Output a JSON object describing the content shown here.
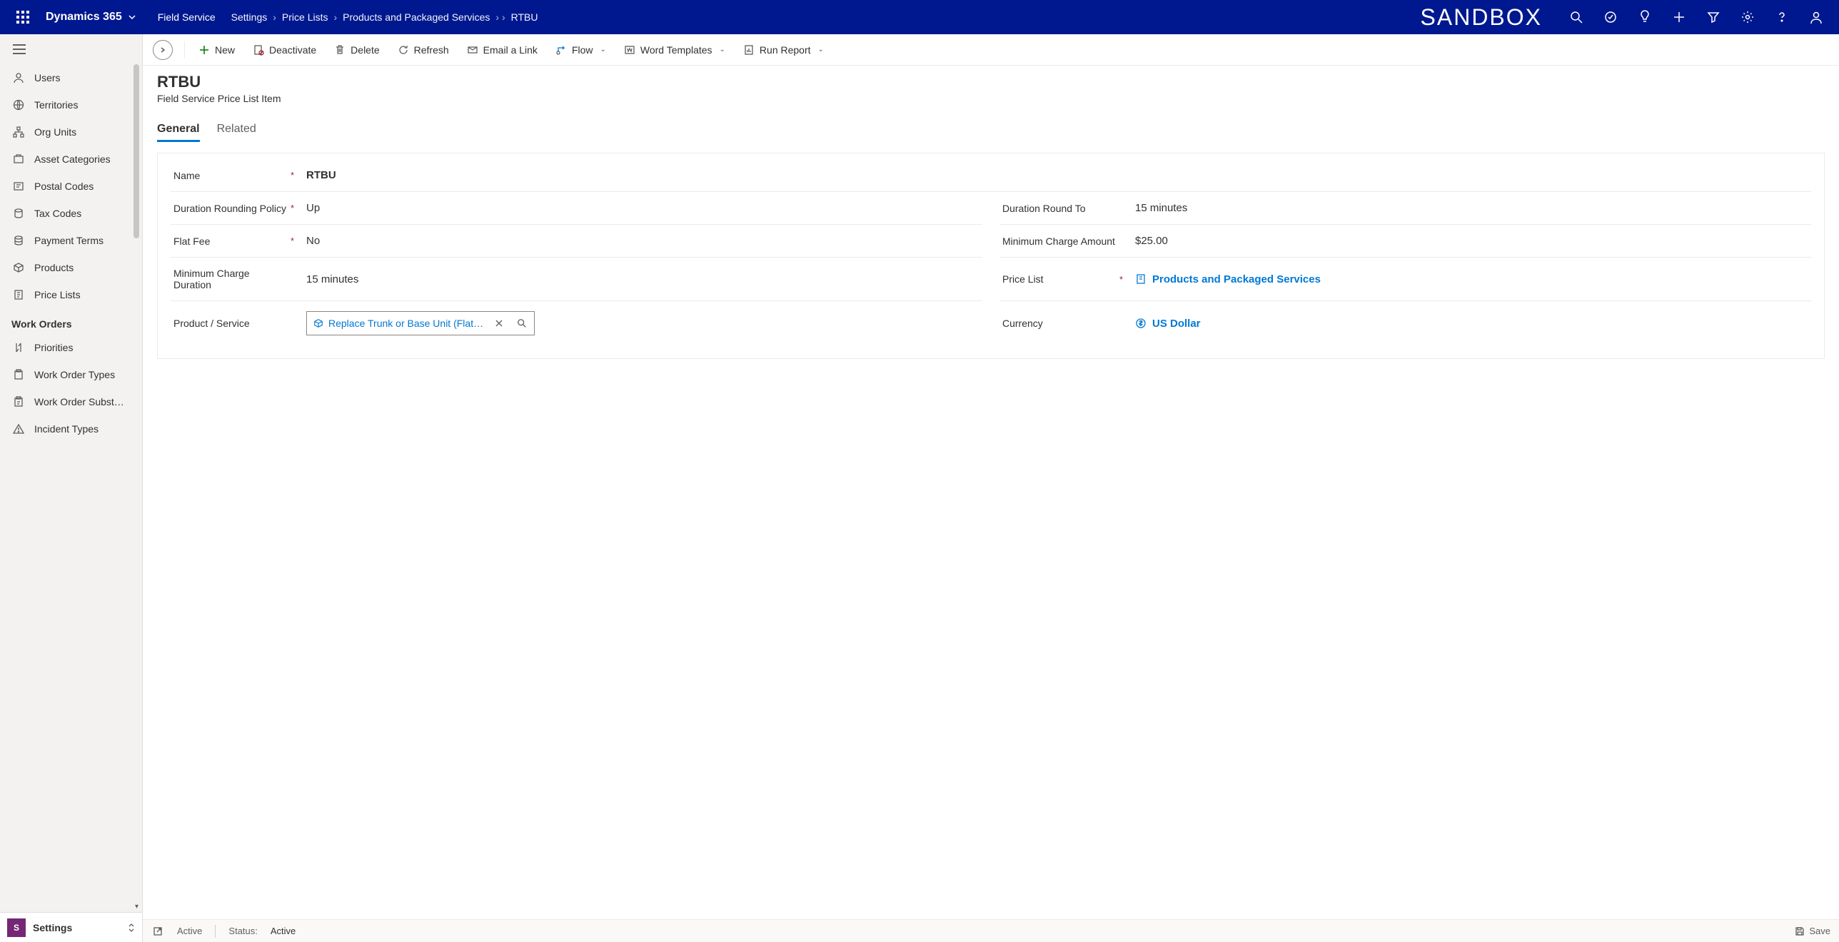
{
  "topbar": {
    "brand": "Dynamics 365",
    "area": "Field Service",
    "sandbox": "SANDBOX",
    "breadcrumbs": [
      "Settings",
      "Price Lists",
      "Products and Packaged Services",
      "RTBU"
    ]
  },
  "commands": {
    "new": "New",
    "deactivate": "Deactivate",
    "delete": "Delete",
    "refresh": "Refresh",
    "email": "Email a Link",
    "flow": "Flow",
    "word": "Word Templates",
    "report": "Run Report"
  },
  "sidebar": {
    "items": [
      {
        "label": "Users",
        "icon": "person"
      },
      {
        "label": "Territories",
        "icon": "globe"
      },
      {
        "label": "Org Units",
        "icon": "org"
      },
      {
        "label": "Asset Categories",
        "icon": "asset"
      },
      {
        "label": "Postal Codes",
        "icon": "postal"
      },
      {
        "label": "Tax Codes",
        "icon": "tax"
      },
      {
        "label": "Payment Terms",
        "icon": "payment"
      },
      {
        "label": "Products",
        "icon": "products"
      },
      {
        "label": "Price Lists",
        "icon": "pricelist"
      }
    ],
    "group": "Work Orders",
    "items2": [
      {
        "label": "Priorities",
        "icon": "priority"
      },
      {
        "label": "Work Order Types",
        "icon": "wotype"
      },
      {
        "label": "Work Order Subst…",
        "icon": "wosub"
      },
      {
        "label": "Incident Types",
        "icon": "incident"
      }
    ],
    "area_label": "Settings",
    "area_badge": "S"
  },
  "page": {
    "title": "RTBU",
    "subtitle": "Field Service Price List Item",
    "tabs": {
      "general": "General",
      "related": "Related"
    },
    "fields": {
      "name_label": "Name",
      "name_value": "RTBU",
      "rounding_label": "Duration Rounding Policy",
      "rounding_value": "Up",
      "roundto_label": "Duration Round To",
      "roundto_value": "15 minutes",
      "flatfee_label": "Flat Fee",
      "flatfee_value": "No",
      "mincharge_label": "Minimum Charge Amount",
      "mincharge_value": "$25.00",
      "mindur_label": "Minimum Charge Duration",
      "mindur_value": "15 minutes",
      "pricelist_label": "Price List",
      "pricelist_value": "Products and Packaged Services",
      "product_label": "Product / Service",
      "product_value": "Replace Trunk or Base Unit (Flat H…",
      "currency_label": "Currency",
      "currency_value": "US Dollar"
    }
  },
  "statusbar": {
    "state": "Active",
    "status_label": "Status:",
    "status_value": "Active",
    "save": "Save"
  }
}
